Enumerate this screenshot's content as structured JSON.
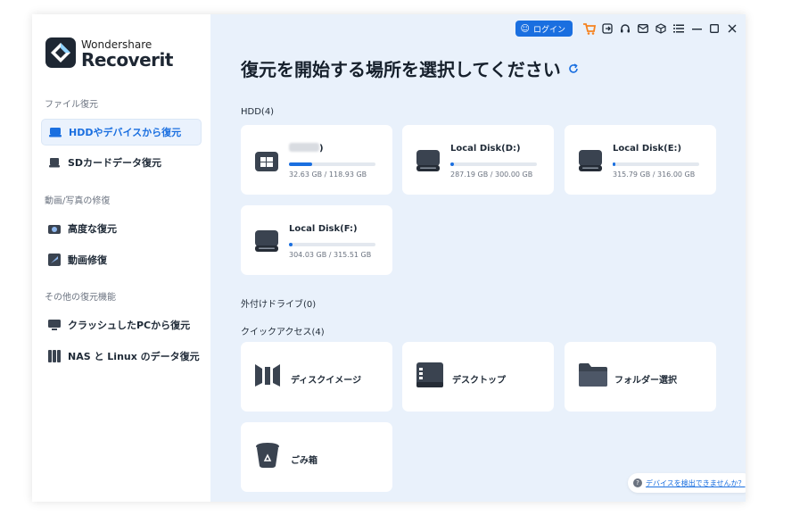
{
  "app": {
    "brand_small": "Wondershare",
    "brand_big": "Recoverit"
  },
  "sidebar": {
    "sections": [
      {
        "label": "ファイル復元"
      },
      {
        "label": "動画/写真の修復"
      },
      {
        "label": "その他の復元機能"
      }
    ],
    "items": [
      {
        "label": "HDDやデバイスから復元",
        "icon": "hdd-icon",
        "active": true
      },
      {
        "label": "SDカードデータ復元",
        "icon": "sd-card-icon"
      },
      {
        "label": "高度な復元",
        "icon": "camera-icon"
      },
      {
        "label": "動画修復",
        "icon": "video-repair-icon"
      },
      {
        "label": "クラッシュしたPCから復元",
        "icon": "monitor-icon"
      },
      {
        "label": "NAS と Linux のデータ復元",
        "icon": "nas-icon"
      }
    ]
  },
  "titlebar": {
    "login_label": "ログイン",
    "icons": [
      "cart-icon",
      "export-icon",
      "headset-icon",
      "mail-icon",
      "box-icon",
      "menu-icon",
      "minimize-icon",
      "maximize-icon",
      "close-icon"
    ]
  },
  "main": {
    "heading": "復元を開始する場所を選択してください",
    "hdd_label": "HDD(4)",
    "disks": [
      {
        "name": ")",
        "size": "32.63 GB / 118.93 GB",
        "used": 0.27,
        "system": true
      },
      {
        "name": "Local Disk(D:)",
        "size": "287.19 GB / 300.00 GB",
        "used": 0.04
      },
      {
        "name": "Local Disk(E:)",
        "size": "315.79 GB / 316.00 GB",
        "used": 0.02
      },
      {
        "name": "Local Disk(F:)",
        "size": "304.03 GB / 315.51 GB",
        "used": 0.04
      }
    ],
    "external_label": "外付けドライブ(0)",
    "quick_label": "クイックアクセス(4)",
    "quick": [
      {
        "label": "ディスクイメージ",
        "icon": "disk-image-icon"
      },
      {
        "label": "デスクトップ",
        "icon": "desktop-icon"
      },
      {
        "label": "フォルダー選択",
        "icon": "folder-icon"
      },
      {
        "label": "ごみ箱",
        "icon": "trash-icon"
      }
    ],
    "help_link": "デバイスを検出できませんか？"
  },
  "colors": {
    "accent": "#1a6fe0",
    "cart": "#f5821f",
    "main_bg": "#e9f1fb",
    "icon_dark": "#3a4350"
  }
}
